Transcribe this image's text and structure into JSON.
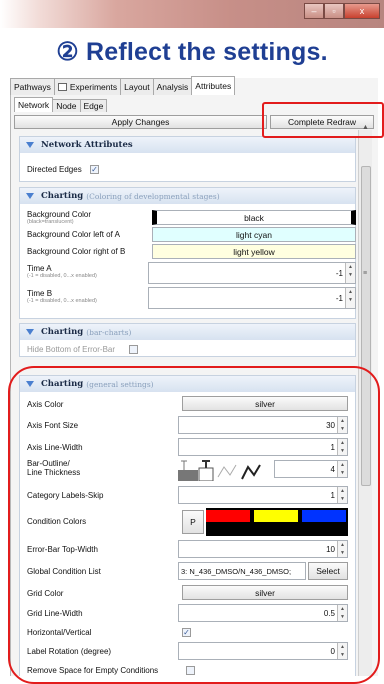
{
  "window": {
    "minimize": "–",
    "restore": "▫",
    "close": "x"
  },
  "headline": "② Reflect the settings.",
  "tabs": [
    {
      "label": "Pathways"
    },
    {
      "label": "Experiments"
    },
    {
      "label": "Layout"
    },
    {
      "label": "Analysis"
    },
    {
      "label": "Attributes"
    }
  ],
  "subtabs": [
    {
      "label": "Network"
    },
    {
      "label": "Node"
    },
    {
      "label": "Edge"
    }
  ],
  "buttons": {
    "apply": "Apply Changes",
    "redraw": "Complete Redraw"
  },
  "sections": {
    "network": {
      "title": "Network Attributes",
      "directed_edges": {
        "label": "Directed Edges",
        "checked": "✓"
      }
    },
    "charting_dev": {
      "title": "Charting",
      "subtitle": "(Coloring of developmental stages)",
      "background_color": {
        "label": "Background Color",
        "hint": "(black=translucent)",
        "value": "black"
      },
      "bg_left": {
        "label": "Background Color left of A",
        "value": "light cyan"
      },
      "bg_right": {
        "label": "Background Color right of B",
        "value": "light yellow"
      },
      "time_a": {
        "label": "Time A",
        "hint": "(-1 = disabled, 0...x enabled)",
        "value": "-1"
      },
      "time_b": {
        "label": "Time B",
        "hint": "(-1 = disabled, 0...x enabled)",
        "value": "-1"
      }
    },
    "charting_bar": {
      "title": "Charting",
      "subtitle": "(bar-charts)",
      "hide_label": "Hide Bottom of Error-Bar"
    },
    "charting_general": {
      "title": "Charting",
      "subtitle": "(general settings)",
      "axis_color": {
        "label": "Axis Color",
        "value": "silver"
      },
      "axis_font_size": {
        "label": "Axis Font Size",
        "value": "30"
      },
      "axis_line_width": {
        "label": "Axis Line-Width",
        "value": "1"
      },
      "bar_outline": {
        "label1": "Bar-Outline/",
        "label2": "Line Thickness",
        "value": "4"
      },
      "category_skip": {
        "label": "Category Labels-Skip",
        "value": "1"
      },
      "condition_colors": {
        "label": "Condition Colors",
        "button": "P"
      },
      "error_bar_width": {
        "label": "Error-Bar Top-Width",
        "value": "10"
      },
      "global_condition": {
        "label": "Global Condition List",
        "value": "3: N_436_DMSO/N_436_DMSO;",
        "button": "Select"
      },
      "grid_color": {
        "label": "Grid Color",
        "value": "silver"
      },
      "grid_line_width": {
        "label": "Grid Line-Width",
        "value": "0.5"
      },
      "horizontal_vertical": {
        "label": "Horizontal/Vertical",
        "checked": "✓"
      },
      "label_rotation": {
        "label": "Label Rotation (degree)",
        "value": "0"
      },
      "remove_space": {
        "label": "Remove Space for Empty Conditions"
      }
    }
  },
  "colors": {
    "headline": "#1f3f93",
    "highlight": "#e21c1c",
    "light_cyan": "#e0ffff",
    "light_yellow": "#ffffe0",
    "silver": "#c0c0c0"
  }
}
